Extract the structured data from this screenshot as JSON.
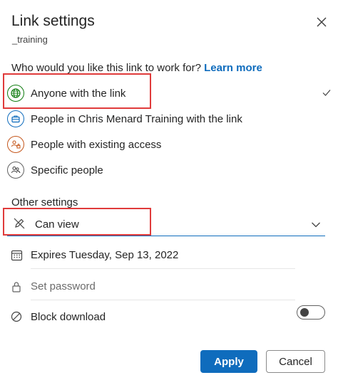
{
  "dialog": {
    "title": "Link settings",
    "subtitle": "_training"
  },
  "question": {
    "text": "Who would you like this link to work for?",
    "link": "Learn more"
  },
  "options": [
    {
      "label": "Anyone with the link",
      "icon": "globe-icon",
      "selected": true
    },
    {
      "label": "People in Chris Menard Training with the link",
      "icon": "briefcase-icon",
      "selected": false
    },
    {
      "label": "People with existing access",
      "icon": "people-lock-icon",
      "selected": false
    },
    {
      "label": "Specific people",
      "icon": "people-icon",
      "selected": false
    }
  ],
  "other_settings": {
    "heading": "Other settings",
    "permission": {
      "value": "Can view",
      "icon": "pencil-off-icon"
    },
    "expires": {
      "label": "Expires Tuesday, Sep 13, 2022",
      "icon": "calendar-icon"
    },
    "password": {
      "placeholder": "Set password",
      "icon": "lock-icon"
    },
    "block_download": {
      "label": "Block download",
      "enabled": false,
      "icon": "block-icon"
    }
  },
  "buttons": {
    "apply": "Apply",
    "cancel": "Cancel"
  },
  "colors": {
    "accent": "#0f6cbd",
    "highlight_box": "#e03b3b",
    "globe": "#107c10",
    "briefcase": "#0f6cbd",
    "people_lock": "#c4551a"
  }
}
